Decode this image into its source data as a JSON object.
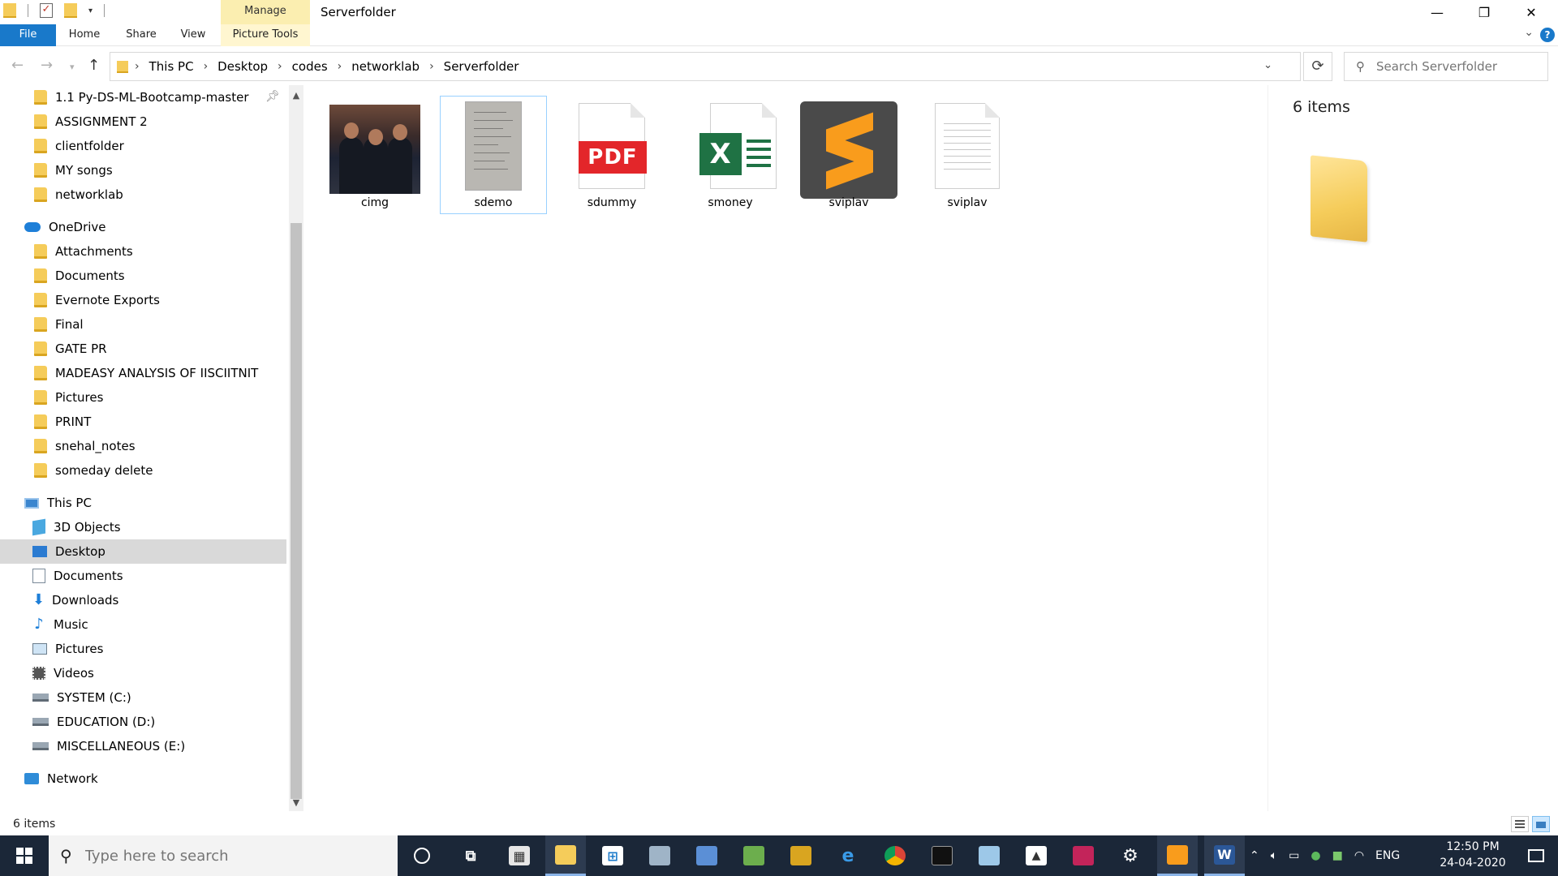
{
  "window": {
    "title": "Serverfolder",
    "manage_label": "Manage",
    "minimize_glyph": "—",
    "restore_glyph": "❐",
    "close_glyph": "✕"
  },
  "ribbon": {
    "tabs": [
      "File",
      "Home",
      "Share",
      "View",
      "Picture Tools"
    ],
    "help_glyph": "?"
  },
  "address": {
    "crumbs": [
      "This PC",
      "Desktop",
      "codes",
      "networklab",
      "Serverfolder"
    ],
    "crumb_separator": "›",
    "search_placeholder": "Search Serverfolder"
  },
  "nav": {
    "quick_access": [
      "1.1 Py-DS-ML-Bootcamp-master",
      "ASSIGNMENT 2",
      "clientfolder",
      "MY songs",
      "networklab"
    ],
    "onedrive_label": "OneDrive",
    "onedrive_items": [
      "Attachments",
      "Documents",
      "Evernote Exports",
      "Final",
      "GATE PR",
      "MADEASY ANALYSIS OF IISCIITNIT",
      "Pictures",
      "PRINT",
      "snehal_notes",
      "someday delete"
    ],
    "thispc_label": "This PC",
    "thispc_items": [
      {
        "label": "3D Objects",
        "icon": "3d-objects-icon"
      },
      {
        "label": "Desktop",
        "icon": "desktop-icon",
        "selected": true
      },
      {
        "label": "Documents",
        "icon": "documents-icon"
      },
      {
        "label": "Downloads",
        "icon": "downloads-icon"
      },
      {
        "label": "Music",
        "icon": "music-icon"
      },
      {
        "label": "Pictures",
        "icon": "pictures-icon"
      },
      {
        "label": "Videos",
        "icon": "videos-icon"
      },
      {
        "label": "SYSTEM (C:)",
        "icon": "drive-icon"
      },
      {
        "label": "EDUCATION (D:)",
        "icon": "drive-icon"
      },
      {
        "label": "MISCELLANEOUS (E:)",
        "icon": "drive-icon"
      }
    ],
    "network_label": "Network"
  },
  "files": [
    {
      "name": "cimg",
      "kind": "photo"
    },
    {
      "name": "sdemo",
      "kind": "paper-photo",
      "selected": true
    },
    {
      "name": "sdummy",
      "kind": "pdf",
      "badge": "PDF"
    },
    {
      "name": "smoney",
      "kind": "excel",
      "badge": "X"
    },
    {
      "name": "sviplav",
      "kind": "sublime"
    },
    {
      "name": "sviplav",
      "kind": "text"
    }
  ],
  "preview": {
    "count_text": "6 items"
  },
  "status": {
    "text": "6 items"
  },
  "taskbar": {
    "search_placeholder": "Type here to search",
    "language": "ENG",
    "time": "12:50 PM",
    "date": "24-04-2020",
    "colors": {
      "bar": "#1b2738",
      "accent": "#1979ca"
    }
  }
}
